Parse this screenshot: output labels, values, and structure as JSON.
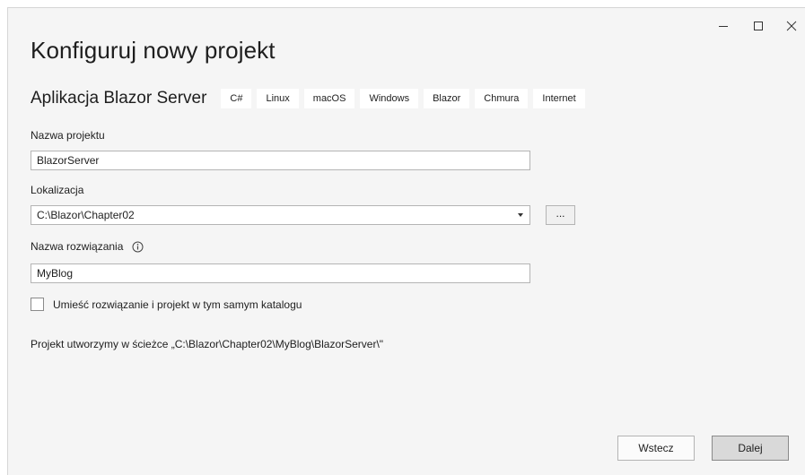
{
  "window": {
    "controls": {
      "minimize_icon": "minimize-icon",
      "maximize_icon": "maximize-icon",
      "close_icon": "close-icon"
    }
  },
  "page": {
    "title": "Konfiguruj nowy projekt"
  },
  "template": {
    "name": "Aplikacja Blazor Server",
    "tags": [
      "C#",
      "Linux",
      "macOS",
      "Windows",
      "Blazor",
      "Chmura",
      "Internet"
    ]
  },
  "form": {
    "project_name_label": "Nazwa projektu",
    "project_name_value": "BlazorServer",
    "location_label": "Lokalizacja",
    "location_value": "C:\\Blazor\\Chapter02",
    "browse_label": "...",
    "solution_name_label": "Nazwa rozwiązania",
    "solution_name_value": "MyBlog",
    "same_dir_label": "Umieść rozwiązanie i projekt w tym samym katalogu",
    "same_dir_checked": false,
    "path_note": "Projekt utworzymy w ścieżce „C:\\Blazor\\Chapter02\\MyBlog\\BlazorServer\\\""
  },
  "footer": {
    "back_label": "Wstecz",
    "next_label": "Dalej"
  },
  "colors": {
    "background": "#f5f5f5",
    "tag_background": "#ffffff",
    "next_button": "#d9d9d9"
  }
}
